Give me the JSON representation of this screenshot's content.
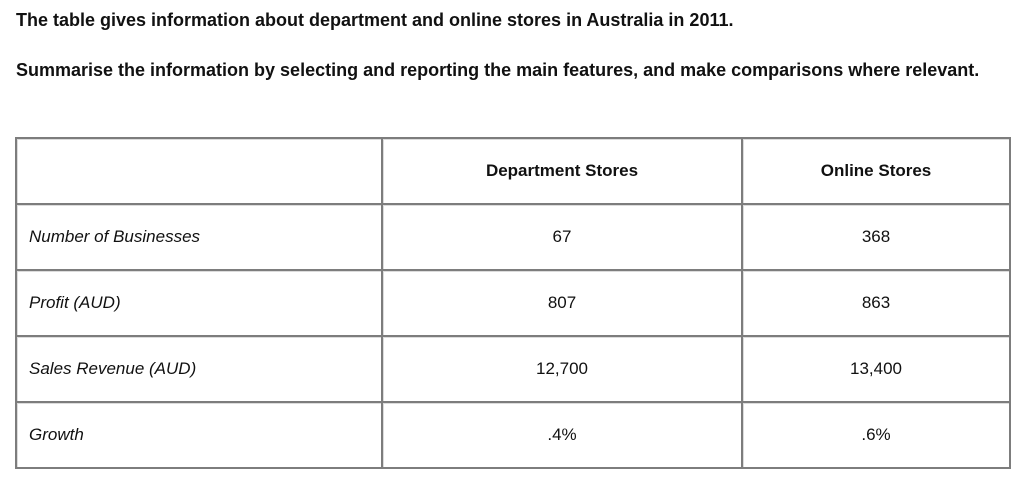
{
  "instructions": {
    "line1": "The table gives information about department and online stores in Australia in 2011.",
    "line2": "Summarise the information by selecting and reporting the main features, and make comparisons where relevant."
  },
  "table": {
    "corner": "",
    "columns": [
      "Department Stores",
      "Online Stores"
    ],
    "rows": [
      {
        "label": "Number of Businesses",
        "values": [
          "67",
          "368"
        ]
      },
      {
        "label": "Profit (AUD)",
        "values": [
          "807",
          "863"
        ]
      },
      {
        "label": "Sales Revenue (AUD)",
        "values": [
          "12,700",
          "13,400"
        ]
      },
      {
        "label": "Growth",
        "values": [
          ".4%",
          ".6%"
        ]
      }
    ]
  }
}
